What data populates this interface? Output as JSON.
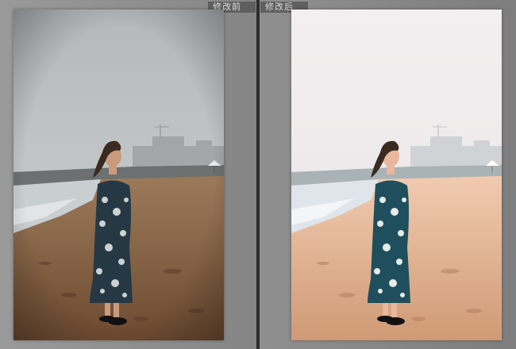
{
  "labels": {
    "before": "修改前",
    "after": "修改后"
  },
  "colors": {
    "before": {
      "sky_top": "#b4b8bb",
      "sky_bottom": "#d2d4d3",
      "haze": "#c6c8c7",
      "city": "#9ea2a2",
      "sea": "#c9ced1",
      "sand_top": "#9b7a5a",
      "sand_bottom": "#6d4a30",
      "dress": "#263844",
      "hair": "#3a2a20",
      "skin": "#c99b7d"
    },
    "after": {
      "sky_top": "#f2eff0",
      "sky_bottom": "#eae5e6",
      "haze": "#e3dfe0",
      "city": "#cdd1d4",
      "sea": "#dfe5ea",
      "sand_top": "#f1cbb0",
      "sand_bottom": "#cf9a75",
      "dress": "#1f4f5c",
      "hair": "#3a2a20",
      "skin": "#e7b89d"
    }
  }
}
